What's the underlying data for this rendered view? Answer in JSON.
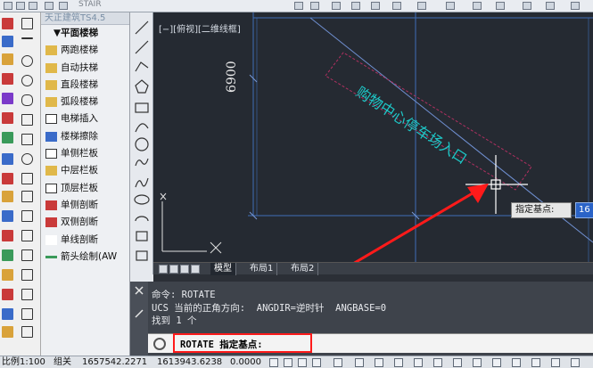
{
  "topbar": {
    "title_fragment": "STAIR"
  },
  "tangent_menu": {
    "title": "天正建筑TS4.5",
    "section": "▼平面楼梯",
    "items": [
      "两跑楼梯",
      "自动扶梯",
      "直段楼梯",
      "弧段楼梯",
      "电梯插入",
      "楼梯擦除",
      "单侧栏板",
      "中层栏板",
      "顶层栏板",
      "单侧剖断",
      "双侧剖断",
      "单线剖断",
      "箭头绘制(AW"
    ]
  },
  "viewport": {
    "label": "[−][俯视][二维线框]",
    "dimension_text": "6900",
    "annotation_text": "购物中心停车场入口",
    "tooltip_label": "指定基点:",
    "tooltip_value": "16",
    "annotation_color": "#1ec8c8",
    "highlight_color": "#ff1a1a"
  },
  "layout_tabs": [
    "模型",
    "布局1",
    "布局2"
  ],
  "command": {
    "history": [
      "命令: ROTATE",
      "UCS 当前的正角方向:  ANGDIR=逆时针  ANGBASE=0",
      "找到 1 个"
    ],
    "prompt": "ROTATE 指定基点:"
  },
  "status_bar": {
    "scale": "比例1:100",
    "group": "组关",
    "coord_x": "1657542.2271",
    "coord_y": "1613943.6238",
    "coord_z": "0.0000"
  }
}
